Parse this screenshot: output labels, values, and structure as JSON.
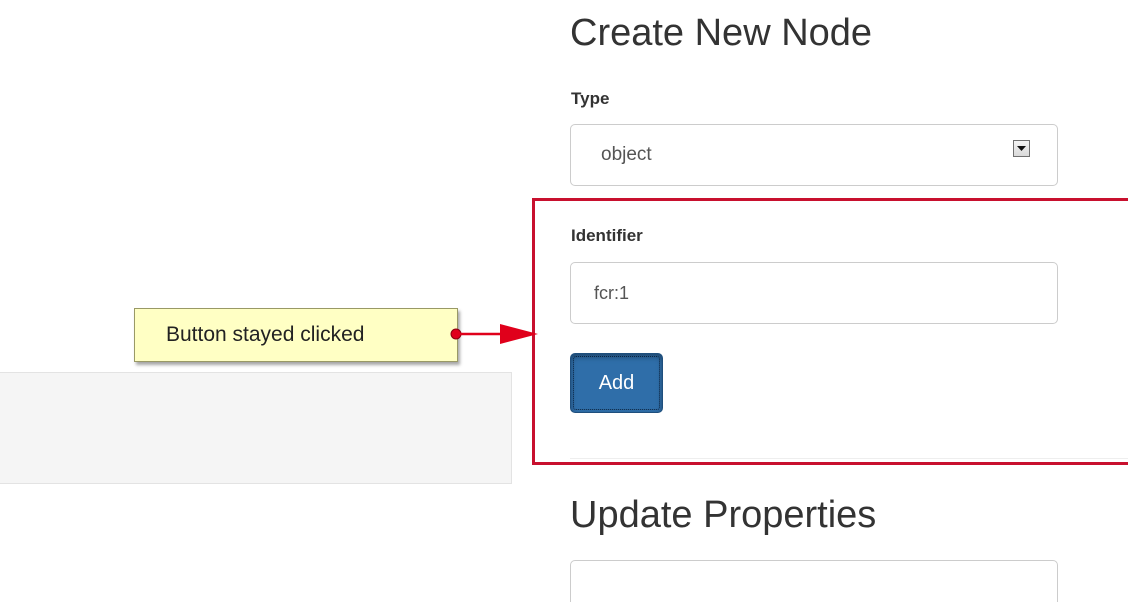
{
  "create_section": {
    "title": "Create New Node",
    "type_label": "Type",
    "type_value": "object",
    "identifier_label": "Identifier",
    "identifier_value": "fcr:1",
    "add_button_label": "Add"
  },
  "update_section": {
    "title": "Update Properties",
    "input_value": ""
  },
  "annotation": {
    "callout_text": "Button stayed clicked",
    "highlight_color": "#c8102e",
    "callout_color": "#ffffc4"
  },
  "colors": {
    "primary_button": "#2f6ea9"
  },
  "icons": {
    "select_arrow": "chevron-down-icon",
    "callout_arrow": "arrow-right-icon"
  }
}
